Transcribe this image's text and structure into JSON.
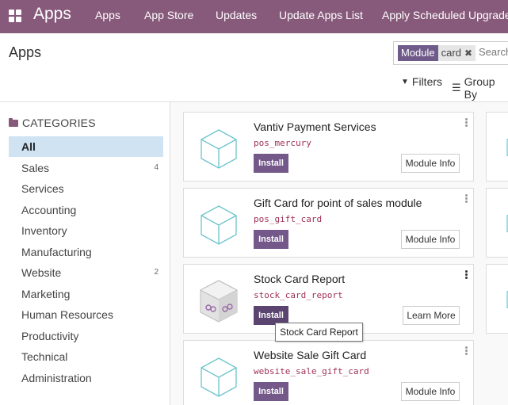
{
  "navbar": {
    "brand": "Apps",
    "items": [
      "Apps",
      "App Store",
      "Updates",
      "Update Apps List",
      "Apply Scheduled Upgrades"
    ],
    "color": "#875a7b"
  },
  "control_panel": {
    "title": "Apps",
    "search": {
      "facet_category": "Module",
      "facet_value": "card",
      "placeholder": "Search..."
    },
    "filters_label": "Filters",
    "groupby_label": "Group By"
  },
  "sidebar": {
    "title": "CATEGORIES",
    "items": [
      {
        "label": "All",
        "count": ""
      },
      {
        "label": "Sales",
        "count": "4"
      },
      {
        "label": "Services",
        "count": ""
      },
      {
        "label": "Accounting",
        "count": ""
      },
      {
        "label": "Inventory",
        "count": ""
      },
      {
        "label": "Manufacturing",
        "count": ""
      },
      {
        "label": "Website",
        "count": "2"
      },
      {
        "label": "Marketing",
        "count": ""
      },
      {
        "label": "Human Resources",
        "count": ""
      },
      {
        "label": "Productivity",
        "count": ""
      },
      {
        "label": "Technical",
        "count": ""
      },
      {
        "label": "Administration",
        "count": ""
      }
    ]
  },
  "cards": [
    {
      "name": "Vantiv Payment Services",
      "technical": "pos_mercury",
      "install": "Install",
      "secondary": "Module Info"
    },
    {
      "name": "Gift Card for point of sales module",
      "technical": "pos_gift_card",
      "install": "Install",
      "secondary": "Module Info"
    },
    {
      "name": "Stock Card Report",
      "technical": "stock_card_report",
      "install": "Install",
      "secondary": "Learn More"
    },
    {
      "name": "Website Sale Gift Card",
      "technical": "website_sale_gift_card",
      "install": "Install",
      "secondary": "Module Info"
    }
  ],
  "tooltip": "Stock Card Report"
}
